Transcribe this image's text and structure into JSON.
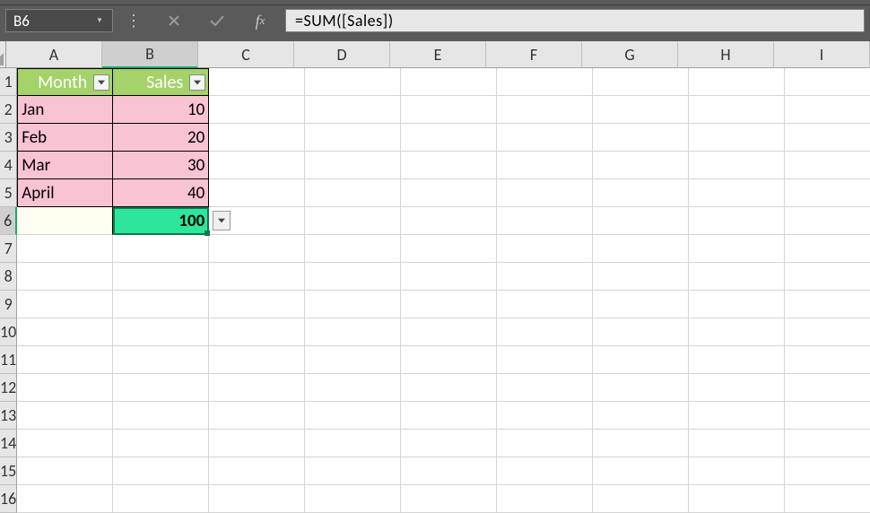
{
  "nameBox": "B6",
  "formula": "=SUM([Sales])",
  "columns": [
    "A",
    "B",
    "C",
    "D",
    "E",
    "F",
    "G",
    "H",
    "I"
  ],
  "rowCount": 16,
  "selectedCol": "B",
  "selectedRow": 6,
  "table": {
    "headers": [
      "Month",
      "Sales"
    ],
    "rows": [
      {
        "month": "Jan",
        "sales": "10"
      },
      {
        "month": "Feb",
        "sales": "20"
      },
      {
        "month": "Mar",
        "sales": "30"
      },
      {
        "month": "April",
        "sales": "40"
      }
    ],
    "total": "100"
  },
  "colors": {
    "header": "#a5d269",
    "data": "#f8c3d3",
    "total": "#2ee59d",
    "gridHeader": "#e6e6e6"
  },
  "chart_data": {
    "type": "table",
    "title": "",
    "columns": [
      "Month",
      "Sales"
    ],
    "rows": [
      [
        "Jan",
        10
      ],
      [
        "Feb",
        20
      ],
      [
        "Mar",
        30
      ],
      [
        "April",
        40
      ]
    ],
    "total": 100
  }
}
